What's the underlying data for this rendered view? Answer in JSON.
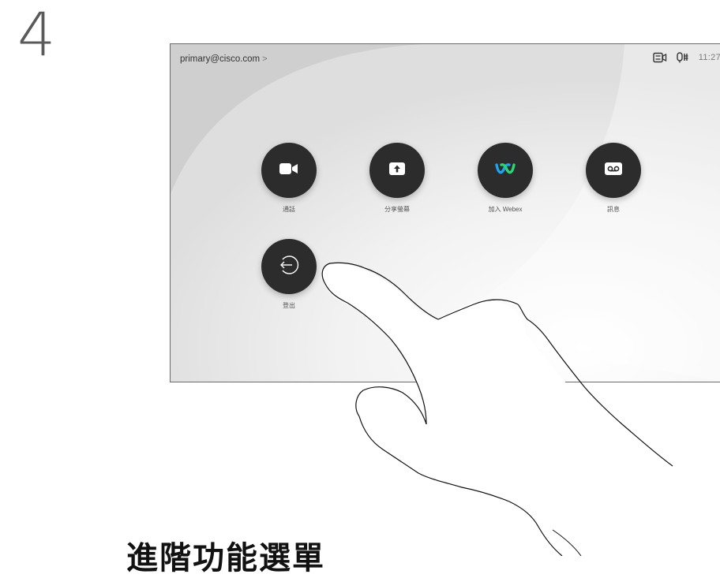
{
  "step": {
    "number": "4"
  },
  "status_bar": {
    "account": "primary@cisco.com",
    "chevron": ">",
    "camera_icon": "camera-share-icon",
    "mic_icon": "microphone-icon",
    "clock": "11:27"
  },
  "home_tiles": [
    {
      "id": "call",
      "label": "通話",
      "icon": "video-camera-icon"
    },
    {
      "id": "share",
      "label": "分享螢幕",
      "icon": "share-screen-icon"
    },
    {
      "id": "webex",
      "label": "加入 Webex",
      "icon": "webex-logo-icon"
    },
    {
      "id": "voicemail",
      "label": "訊息",
      "icon": "voicemail-icon"
    },
    {
      "id": "signout",
      "label": "登出",
      "icon": "sign-out-icon"
    }
  ],
  "colors": {
    "tile_bg": "#2c2c2c",
    "webex_blue": "#1ea5f0",
    "webex_green": "#2ed573"
  },
  "caption": "進階功能選單"
}
